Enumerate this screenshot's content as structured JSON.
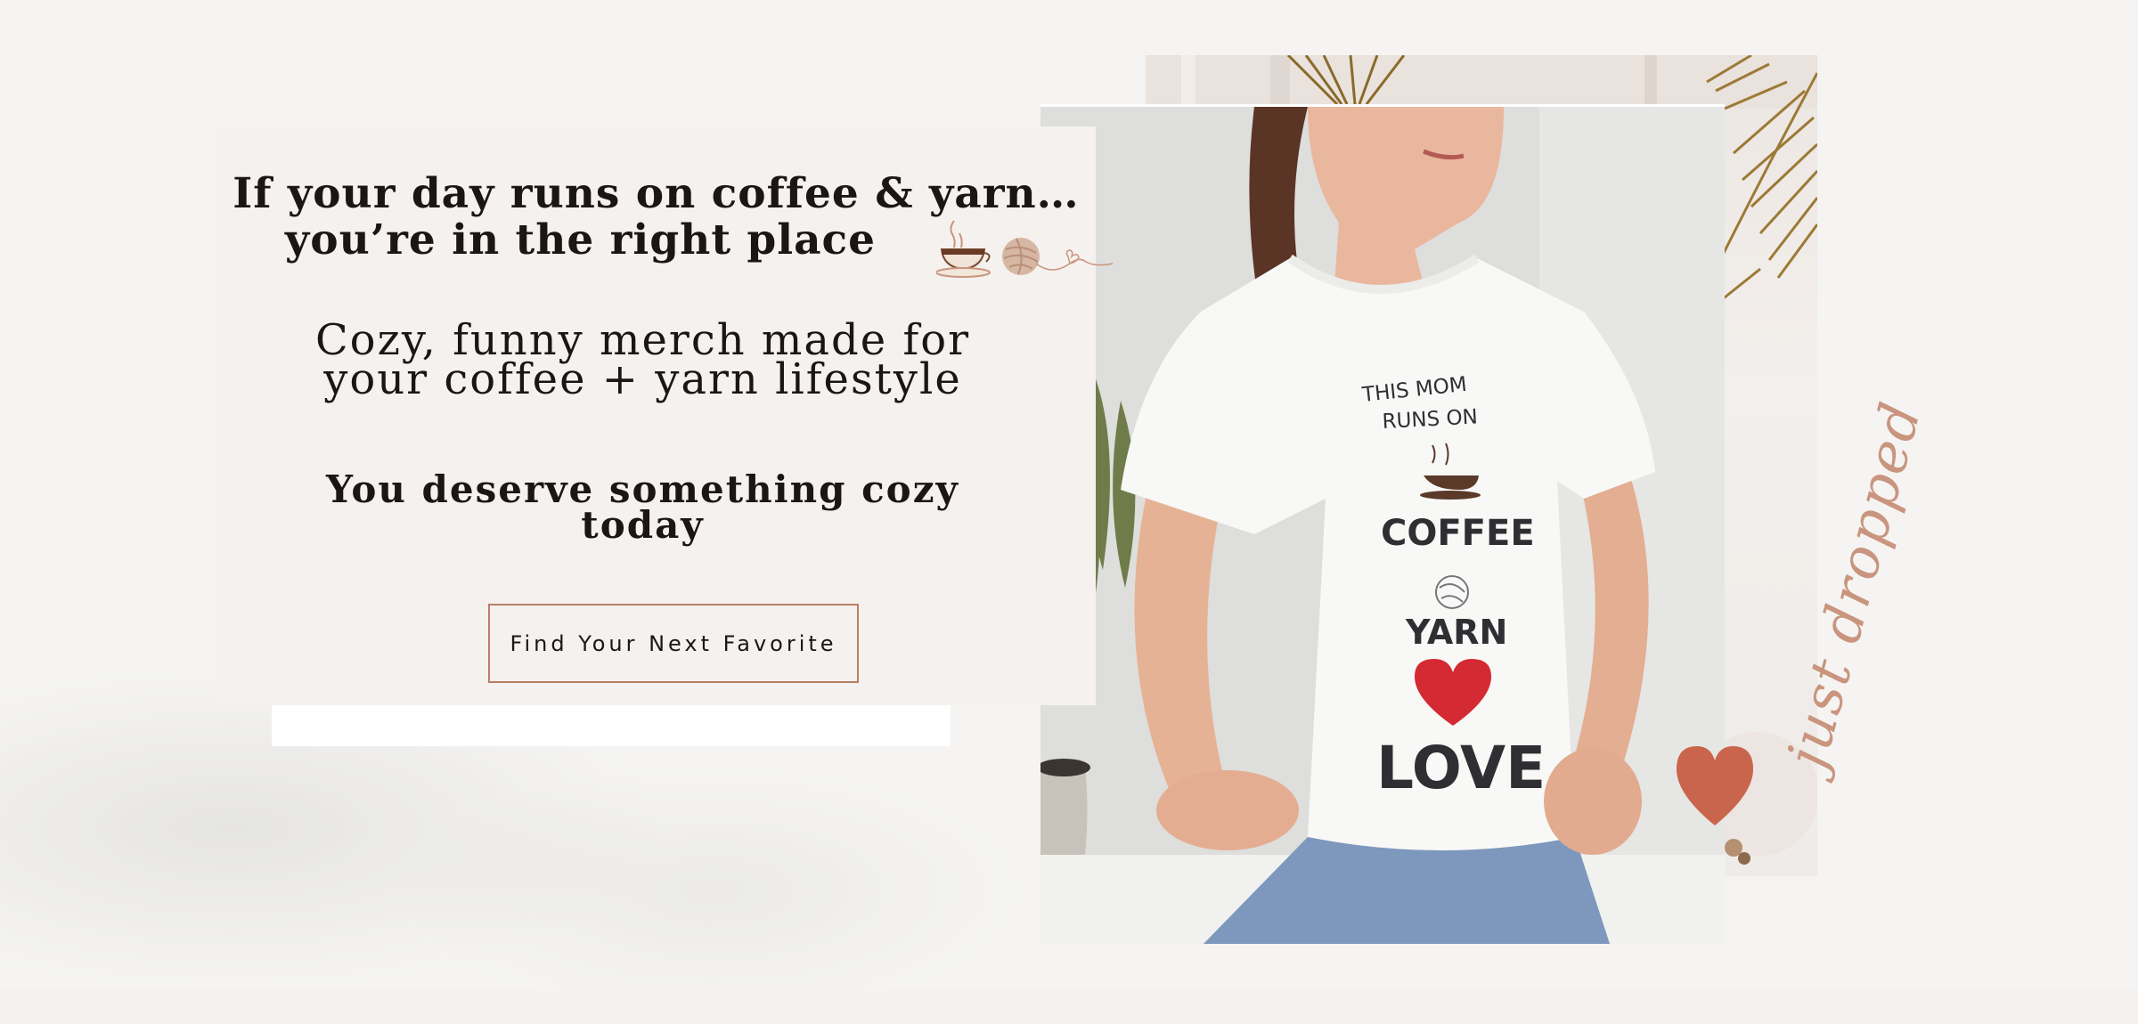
{
  "hero": {
    "headline_line1": "If your day runs on coffee & yarn…",
    "headline_line2": "you’re in the right place",
    "subhead_line1": "Cozy, funny merch made for",
    "subhead_line2": "your coffee + yarn lifestyle",
    "tagline_line1": "You deserve something cozy",
    "tagline_line2": "today",
    "cta_label": "Find Your Next Favorite"
  },
  "product_photo": {
    "shirt_line1": "THIS MOM",
    "shirt_line2": "RUNS ON",
    "shirt_word1": "COFFEE",
    "shirt_word2": "YARN",
    "shirt_word3": "LOVE"
  },
  "decor": {
    "script_text": "just dropped",
    "icons": [
      "coffee-cup-icon",
      "yarn-ball-icon",
      "heart-icon"
    ]
  },
  "colors": {
    "background": "#f5f4f2",
    "card": "#f5f1ee",
    "text": "#1c1515",
    "accent": "#b97f64",
    "heart": "#c9654d"
  }
}
